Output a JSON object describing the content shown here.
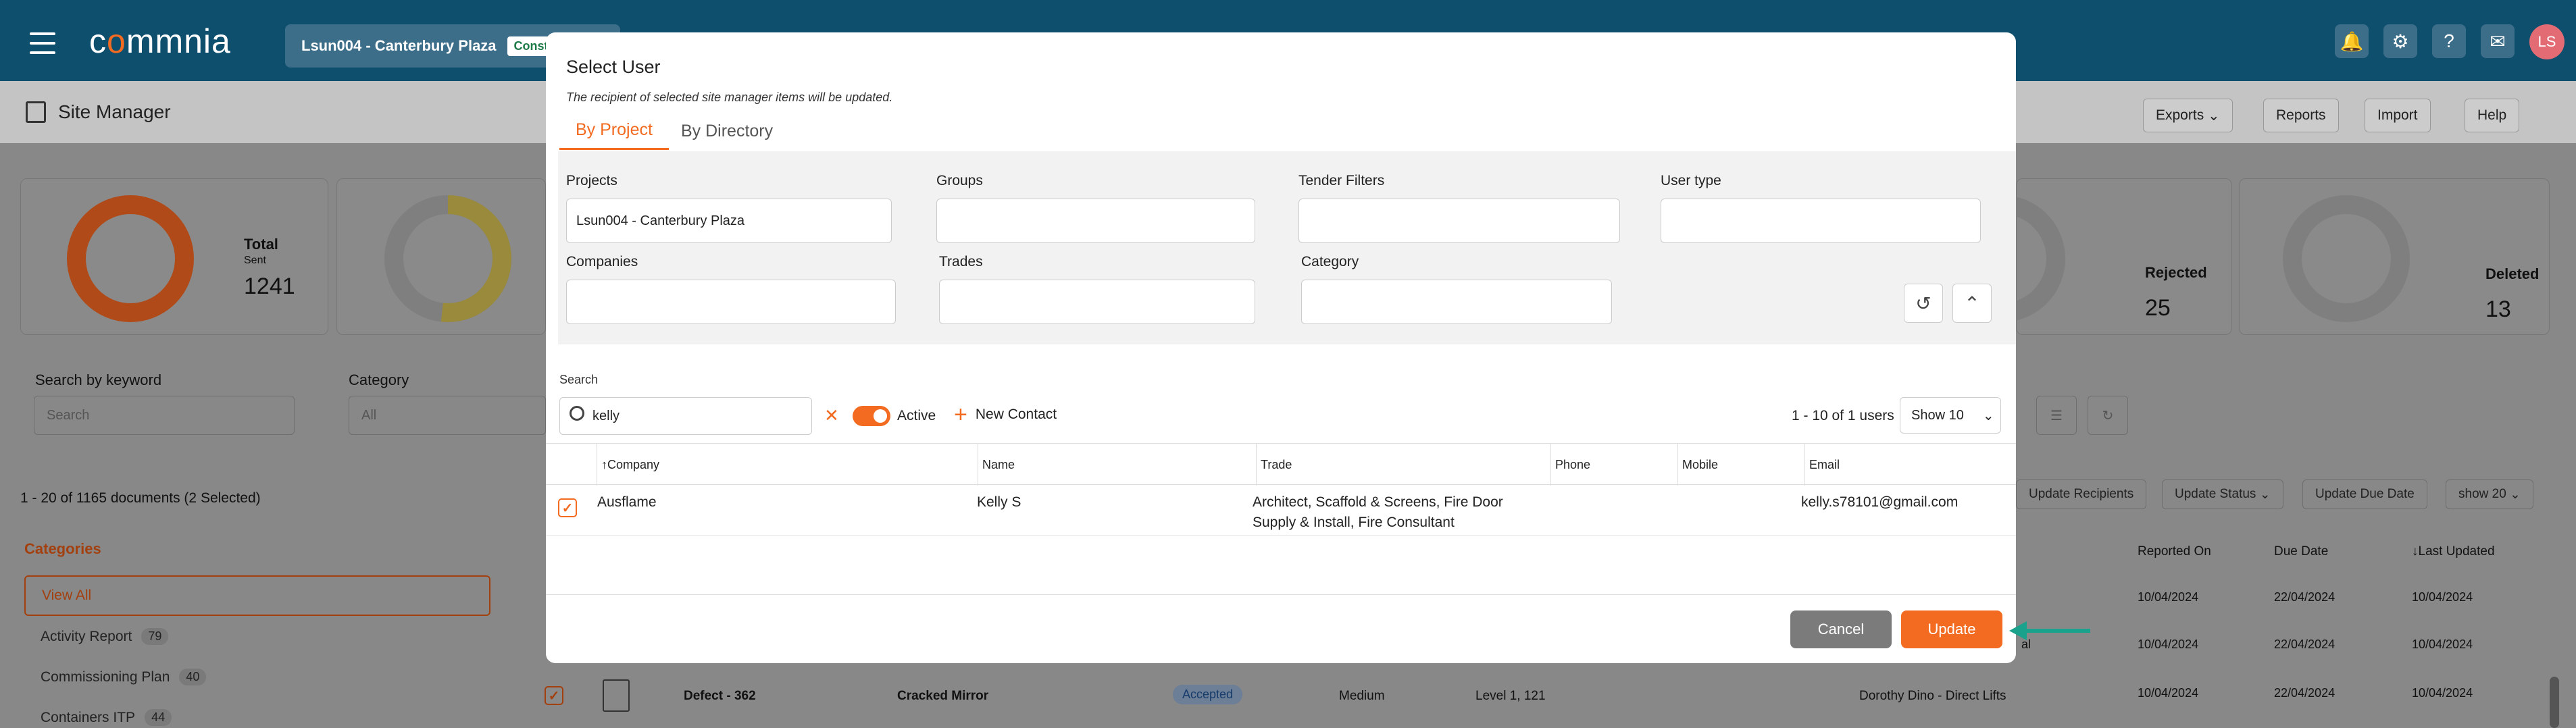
{
  "app": {
    "logo_part1": "c",
    "logo_o": "o",
    "logo_part2": "mmnia",
    "project_chip": "Lsun004 - Canterbury Plaza",
    "project_status": "Construc",
    "avatar_initials": "LS"
  },
  "header": {
    "title": "Site Manager",
    "exports": "Exports",
    "reports": "Reports",
    "import": "Import",
    "help": "Help"
  },
  "background": {
    "stats": [
      {
        "label": "Total",
        "sub": "Sent",
        "value": "1241"
      },
      {
        "label": "Rejected",
        "value": "25"
      },
      {
        "label": "Deleted",
        "value": "13"
      }
    ],
    "search_label": "Search by keyword",
    "search_placeholder": "Search",
    "category_label": "Category",
    "category_value": "All",
    "doc_count": "1 - 20 of 1165 documents (2 Selected)",
    "update_recipients": "Update Recipients",
    "update_status": "Update Status",
    "update_due_date": "Update Due Date",
    "show": "show 20",
    "categories_title": "Categories",
    "categories": [
      {
        "name": "View All",
        "count": ""
      },
      {
        "name": "Activity Report",
        "count": "79"
      },
      {
        "name": "Commissioning Plan",
        "count": "40"
      },
      {
        "name": "Containers ITP",
        "count": "44"
      }
    ],
    "col_reported_on": "Reported On",
    "col_due_date": "Due Date",
    "col_last_updated": "↓Last Updated",
    "rows": [
      {
        "reported": "10/04/2024",
        "due": "22/04/2024",
        "updated": "10/04/2024",
        "extra": ""
      },
      {
        "reported": "10/04/2024",
        "due": "22/04/2024",
        "updated": "10/04/2024",
        "extra": "al"
      },
      {
        "reported": "10/04/2024",
        "due": "22/04/2024",
        "updated": "10/04/2024",
        "extra": ""
      }
    ],
    "defect_id": "Defect - 362",
    "defect_title": "Cracked Mirror",
    "defect_status": "Accepted",
    "defect_priority": "Medium",
    "defect_location": "Level 1, 121",
    "defect_assignee": "Dorothy Dino - Direct Lifts"
  },
  "modal": {
    "title": "Select User",
    "subtitle": "The recipient of selected site manager items will be updated.",
    "tabs": [
      "By Project",
      "By Directory"
    ],
    "filters": {
      "projects_label": "Projects",
      "projects_value": "Lsun004 - Canterbury Plaza",
      "groups_label": "Groups",
      "tender_label": "Tender Filters",
      "usertype_label": "User type",
      "companies_label": "Companies",
      "trades_label": "Trades",
      "category_label": "Category"
    },
    "search_label": "Search",
    "search_value": "kelly",
    "active_label": "Active",
    "new_contact": "New Contact",
    "count": "1 - 10 of 1 users",
    "show": "Show 10",
    "columns": [
      "↑Company",
      "Name",
      "Trade",
      "Phone",
      "Mobile",
      "Email"
    ],
    "rows": [
      {
        "company": "Ausflame",
        "name": "Kelly S",
        "trade_line1": "Architect, Scaffold & Screens, Fire Door",
        "trade_line2": "Supply & Install, Fire Consultant",
        "phone": "",
        "mobile": "",
        "email": "kelly.s78101@gmail.com"
      }
    ],
    "cancel": "Cancel",
    "update": "Update"
  },
  "colors": {
    "brand_navy": "#0e4f6e",
    "accent_orange": "#f26b21",
    "arrow_green": "#1aa28c"
  }
}
